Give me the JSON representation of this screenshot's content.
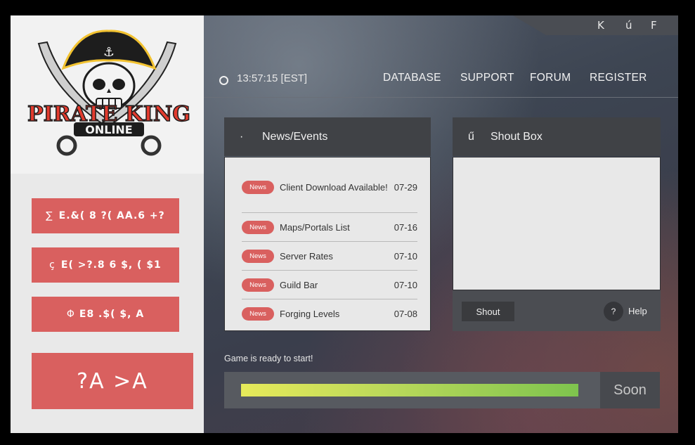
{
  "window": {
    "corner_buttons": [
      "K",
      "ú",
      "F"
    ]
  },
  "logo": {
    "line1": "PIRATE KING",
    "line2": "ONLINE",
    "colors": {
      "red": "#e23b2e",
      "yellow": "#f2c230",
      "dark": "#1d1d1d"
    }
  },
  "sidebar": {
    "buttons": [
      {
        "icon": "∑",
        "label": "E.&( 8 ?( AA.6 +?"
      },
      {
        "icon": "ç",
        "label": "E( >?.8 6 $, ( $1"
      },
      {
        "icon": "Φ",
        "label": "E8 .$( $,  A"
      }
    ],
    "play_label": "?A >A"
  },
  "header": {
    "clock": "13:57:15 [EST]",
    "nav": [
      "DATABASE",
      "SUPPORT",
      "FORUM",
      "REGISTER"
    ]
  },
  "news": {
    "icon": "·",
    "title": "News/Events",
    "items": [
      {
        "badge": "News",
        "title": "Client Download Available!",
        "date": "07-29"
      },
      {
        "badge": "News",
        "title": "Maps/Portals List",
        "date": "07-16"
      },
      {
        "badge": "News",
        "title": "Server Rates",
        "date": "07-10"
      },
      {
        "badge": "News",
        "title": "Guild Bar",
        "date": "07-10"
      },
      {
        "badge": "News",
        "title": "Forging Levels",
        "date": "07-08"
      }
    ]
  },
  "shoutbox": {
    "icon": "ű",
    "title": "Shout Box",
    "shout_label": "Shout",
    "help_icon": "?",
    "help_label": "Help"
  },
  "status": {
    "text": "Game is ready to start!",
    "progress": 1.0,
    "button": "Soon"
  },
  "colors": {
    "accent": "#d9605f",
    "panel_dark": "#404246"
  }
}
